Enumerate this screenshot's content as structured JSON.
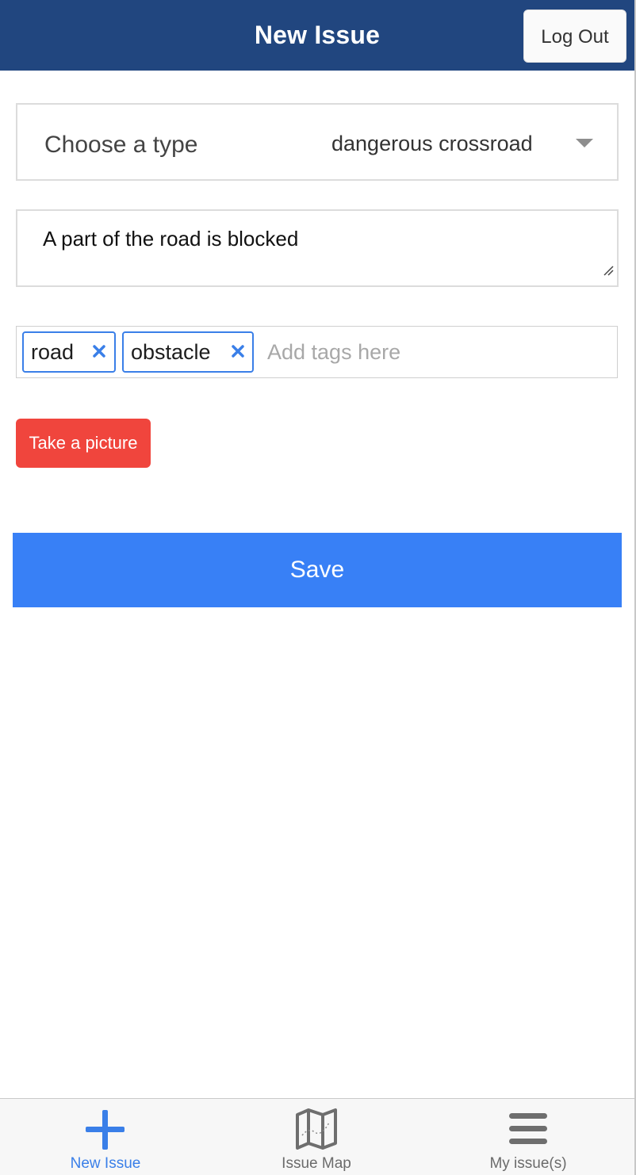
{
  "header": {
    "title": "New Issue",
    "logout_label": "Log Out"
  },
  "form": {
    "type_label": "Choose a type",
    "type_value": "dangerous crossroad",
    "description": "A part of the road is blocked",
    "tags": [
      "road",
      "obstacle"
    ],
    "tags_placeholder": "Add tags here",
    "picture_label": "Take a picture",
    "save_label": "Save"
  },
  "tabbar": {
    "items": [
      {
        "label": "New Issue",
        "icon": "plus-icon",
        "active": true
      },
      {
        "label": "Issue Map",
        "icon": "map-icon",
        "active": false
      },
      {
        "label": "My issue(s)",
        "icon": "menu-icon",
        "active": false
      }
    ]
  },
  "colors": {
    "header_bg": "#21467f",
    "accent": "#3880f6",
    "picture_button": "#f0453d",
    "tag_border": "#3a7fe8"
  }
}
